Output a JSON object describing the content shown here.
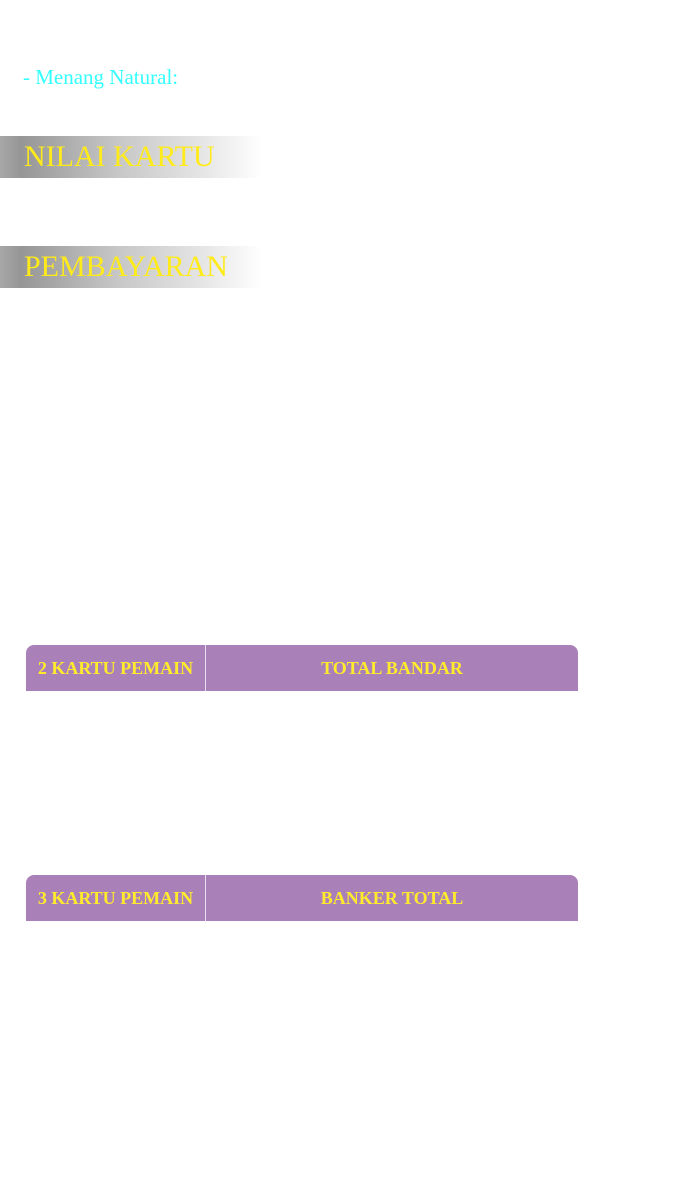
{
  "top_text": "",
  "natural_label": "- Menang Natural:",
  "sections": {
    "nilai_kartu": "NILAI KARTU",
    "pembayaran": "PEMBAYARAN"
  },
  "tables": [
    {
      "left_header": "2 KARTU PEMAIN",
      "right_header": "TOTAL BANDAR"
    },
    {
      "left_header": "3 KARTU PEMAIN",
      "right_header": "BANKER TOTAL"
    }
  ],
  "colors": {
    "accent_cyan": "#33ffff",
    "title_yellow": "#ffeb1a",
    "table_header_bg": "#aa80b9",
    "table_header_text": "#ffeb2c"
  }
}
